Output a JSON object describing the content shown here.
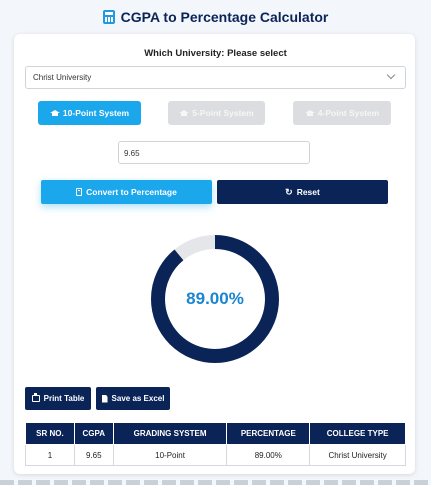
{
  "app": {
    "title": "CGPA to Percentage Calculator",
    "title_icon": "calculator-icon"
  },
  "university": {
    "label": "Which University: Please select",
    "selected": "Christ University"
  },
  "systems": [
    {
      "label": "10-Point System",
      "active": true
    },
    {
      "label": "5-Point System",
      "active": false
    },
    {
      "label": "4-Point System",
      "active": false
    }
  ],
  "cgpa_input": {
    "value": "9.65"
  },
  "actions": {
    "convert_label": "Convert to Percentage",
    "reset_label": "Reset"
  },
  "result": {
    "percentage_text": "89.00%",
    "percentage_value": 89.0
  },
  "export": {
    "print_label": "Print Table",
    "excel_label": "Save as Excel"
  },
  "table": {
    "headers": [
      "SR NO.",
      "CGPA",
      "GRADING SYSTEM",
      "PERCENTAGE",
      "COLLEGE TYPE"
    ],
    "rows": [
      [
        "1",
        "9.65",
        "10-Point",
        "89.00%",
        "Christ University"
      ]
    ]
  },
  "colors": {
    "accent": "#1aa7ec",
    "primary": "#0b2458",
    "gauge_track": "#e4e6ea",
    "result_text": "#1a85d0"
  }
}
